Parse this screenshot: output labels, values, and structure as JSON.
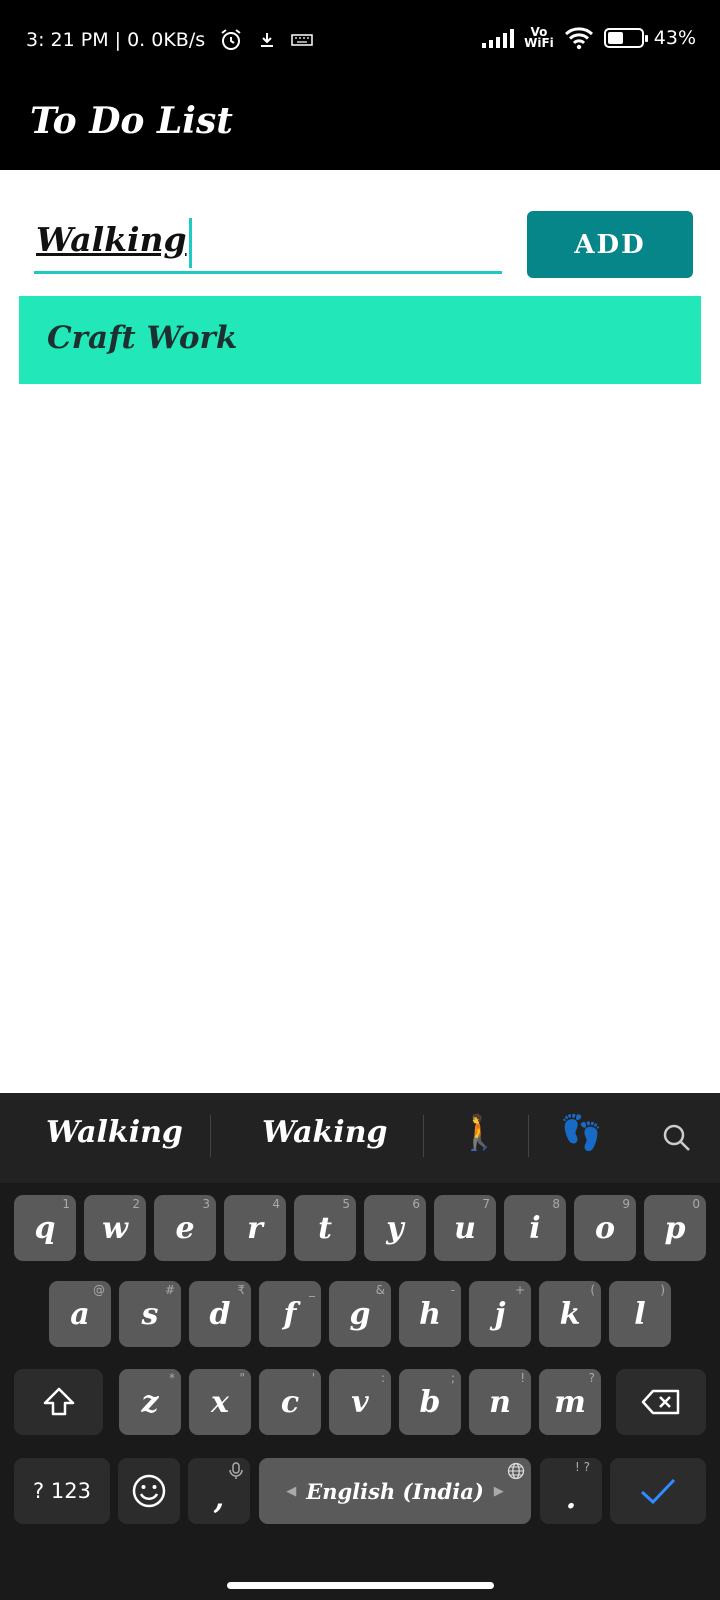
{
  "status": {
    "time": "3: 21 PM | 0. 0KB/s",
    "vowifi_top": "Vo",
    "vowifi_bottom": "WiFi",
    "battery": "43%",
    "battery_level": 0.43
  },
  "app": {
    "title": "To Do List"
  },
  "input": {
    "value": "Walking",
    "add_label": "ADD"
  },
  "tasks": [
    {
      "label": "Craft Work"
    }
  ],
  "keyboard": {
    "suggestions": [
      "Walking",
      "Waking"
    ],
    "emoji_1": "🚶",
    "emoji_2": "👣",
    "row1": [
      {
        "k": "q",
        "h": "1"
      },
      {
        "k": "w",
        "h": "2"
      },
      {
        "k": "e",
        "h": "3"
      },
      {
        "k": "r",
        "h": "4"
      },
      {
        "k": "t",
        "h": "5"
      },
      {
        "k": "y",
        "h": "6"
      },
      {
        "k": "u",
        "h": "7"
      },
      {
        "k": "i",
        "h": "8"
      },
      {
        "k": "o",
        "h": "9"
      },
      {
        "k": "p",
        "h": "0"
      }
    ],
    "row2": [
      {
        "k": "a",
        "h": "@"
      },
      {
        "k": "s",
        "h": "#"
      },
      {
        "k": "d",
        "h": "₹"
      },
      {
        "k": "f",
        "h": "_"
      },
      {
        "k": "g",
        "h": "&"
      },
      {
        "k": "h",
        "h": "-"
      },
      {
        "k": "j",
        "h": "+"
      },
      {
        "k": "k",
        "h": "("
      },
      {
        "k": "l",
        "h": ")"
      }
    ],
    "row3": [
      {
        "k": "z",
        "h": "*"
      },
      {
        "k": "x",
        "h": "\""
      },
      {
        "k": "c",
        "h": "'"
      },
      {
        "k": "v",
        "h": ":"
      },
      {
        "k": "b",
        "h": ";"
      },
      {
        "k": "n",
        "h": "!"
      },
      {
        "k": "m",
        "h": "?"
      }
    ],
    "symbols": "? 123",
    "comma": ",",
    "space": "English (India)",
    "period": ".",
    "period_hint": "! ?"
  }
}
